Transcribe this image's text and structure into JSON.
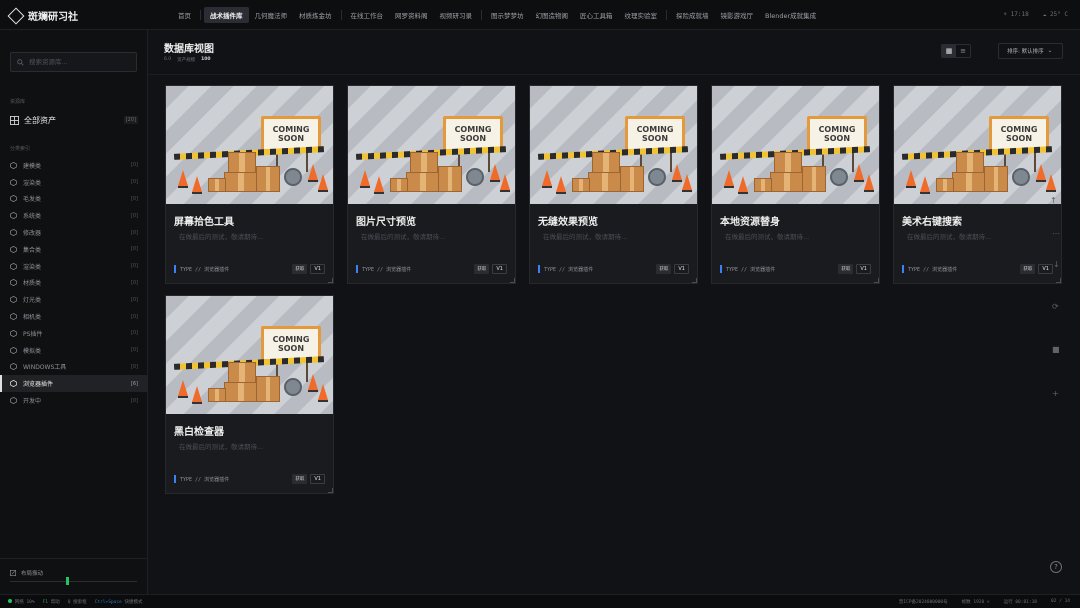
{
  "app": {
    "title": "斑斓研习社"
  },
  "nav": {
    "tabs": [
      "首页",
      "战术插件库",
      "几何魔法师",
      "材质炼金坊",
      "在线工作台",
      "网罗资料阁",
      "视频研习录",
      "图示梦梦坊",
      "幻图造物阁",
      "匠心工具箱",
      "纹理实验室",
      "探险成就墙",
      "镜影游戏厅",
      "Blender成就集成"
    ],
    "active_index": 1
  },
  "topright": {
    "time": "17:18",
    "temp": "25° C"
  },
  "sidebar": {
    "search_placeholder": "搜索资源库...",
    "section_library": "资源库",
    "all_assets_label": "全部资产",
    "all_assets_count": "[20]",
    "section_categories": "分类索引",
    "categories": [
      {
        "label": "建模类",
        "count": "[0]"
      },
      {
        "label": "渲染类",
        "count": "[0]"
      },
      {
        "label": "毛发类",
        "count": "[0]"
      },
      {
        "label": "系统类",
        "count": "[0]"
      },
      {
        "label": "修改器",
        "count": "[0]"
      },
      {
        "label": "集合类",
        "count": "[0]"
      },
      {
        "label": "渲染类",
        "count": "[0]"
      },
      {
        "label": "材质类",
        "count": "[0]"
      },
      {
        "label": "灯光类",
        "count": "[0]"
      },
      {
        "label": "相机类",
        "count": "[0]"
      },
      {
        "label": "PS插件",
        "count": "[0]"
      },
      {
        "label": "模拟类",
        "count": "[0]"
      },
      {
        "label": "WINDOWS工具",
        "count": "[0]"
      },
      {
        "label": "浏览器插件",
        "count": "[6]"
      },
      {
        "label": "开发中",
        "count": "[0]"
      }
    ],
    "active_category_index": 13,
    "display_toggle_label": "布局振动"
  },
  "main": {
    "title": "数据库视图",
    "meta_prefix": "6.0",
    "meta_label": "资产规模",
    "meta_value": "100",
    "sort_label": "排序: 默认排序"
  },
  "cards": [
    {
      "title": "屏幕拾色工具",
      "desc": "在做最后的测试，敬请期待...",
      "type": "TYPE // 浏览器插件",
      "tag": "获取",
      "version": "V1"
    },
    {
      "title": "图片尺寸预览",
      "desc": "在做最后的测试，敬请期待...",
      "type": "TYPE // 浏览器插件",
      "tag": "获取",
      "version": "V1"
    },
    {
      "title": "无缝效果预览",
      "desc": "在做最后的测试，敬请期待...",
      "type": "TYPE // 浏览器插件",
      "tag": "获取",
      "version": "V1"
    },
    {
      "title": "本地资源替身",
      "desc": "在做最后的测试，敬请期待...",
      "type": "TYPE // 浏览器插件",
      "tag": "获取",
      "version": "V1"
    },
    {
      "title": "美术右键搜索",
      "desc": "在做最后的测试，敬请期待...",
      "type": "TYPE // 浏览器插件",
      "tag": "获取",
      "version": "V1"
    },
    {
      "title": "黑白检查器",
      "desc": "在做最后的测试，敬请期待...",
      "type": "TYPE // 浏览器插件",
      "tag": "获取",
      "version": "V1"
    }
  ],
  "thumb": {
    "line1": "COMING",
    "line2": "SOON"
  },
  "statusbar": {
    "net": "网络",
    "net_val": "10%",
    "f1": "F1",
    "f1_label": "帮助",
    "q": "Q",
    "q_label": "搜索框",
    "shortcut": "Ctrl+Space",
    "shortcut_label": "快捷模式",
    "icp": "晋ICP备2024000000号",
    "res_label": "帧数",
    "res": "1920 ×",
    "time_label": "运行",
    "time": "00:01:18",
    "page": "02 / 14"
  },
  "colors": {
    "accent_green": "#22c55e",
    "accent_blue": "#3b82f6",
    "bg": "#111215"
  }
}
